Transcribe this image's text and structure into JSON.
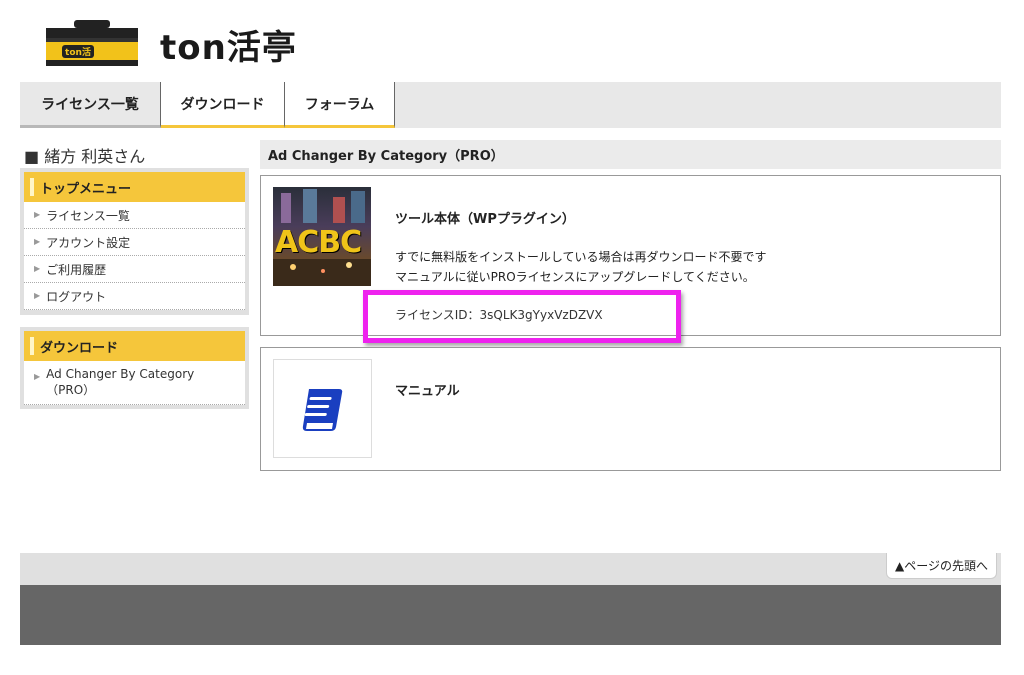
{
  "site": {
    "title": "ton活亭",
    "logo_label": "ton活"
  },
  "nav": {
    "tabs": [
      {
        "label": "ライセンス一覧"
      },
      {
        "label": "ダウンロード"
      },
      {
        "label": "フォーラム"
      }
    ]
  },
  "sidebar": {
    "user_name": "■ 緒方 利英さん",
    "top_menu": {
      "heading": "トップメニュー",
      "items": [
        {
          "label": "ライセンス一覧"
        },
        {
          "label": "アカウント設定"
        },
        {
          "label": "ご利用履歴"
        },
        {
          "label": "ログアウト"
        }
      ]
    },
    "download_menu": {
      "heading": "ダウンロード",
      "items": [
        {
          "label": "Ad Changer By Category（PRO）"
        }
      ]
    }
  },
  "main": {
    "heading": "Ad Changer By Category（PRO）",
    "tool_card": {
      "image_text": "ACBC",
      "title": "ツール本体（WPプラグイン）",
      "desc1": "すでに無料版をインストールしている場合は再ダウンロード不要です",
      "desc2": "マニュアルに従いPROライセンスにアップグレードしてください。",
      "license_line": "ライセンスID：3sQLK3gYyxVzDZVX"
    },
    "manual_card": {
      "icon": "book-icon",
      "title": "マニュアル"
    }
  },
  "footer": {
    "to_top": "▲ページの先頭へ"
  },
  "colors": {
    "accent": "#f5c63b",
    "highlight": "#ee22ee",
    "footer": "#666666"
  }
}
